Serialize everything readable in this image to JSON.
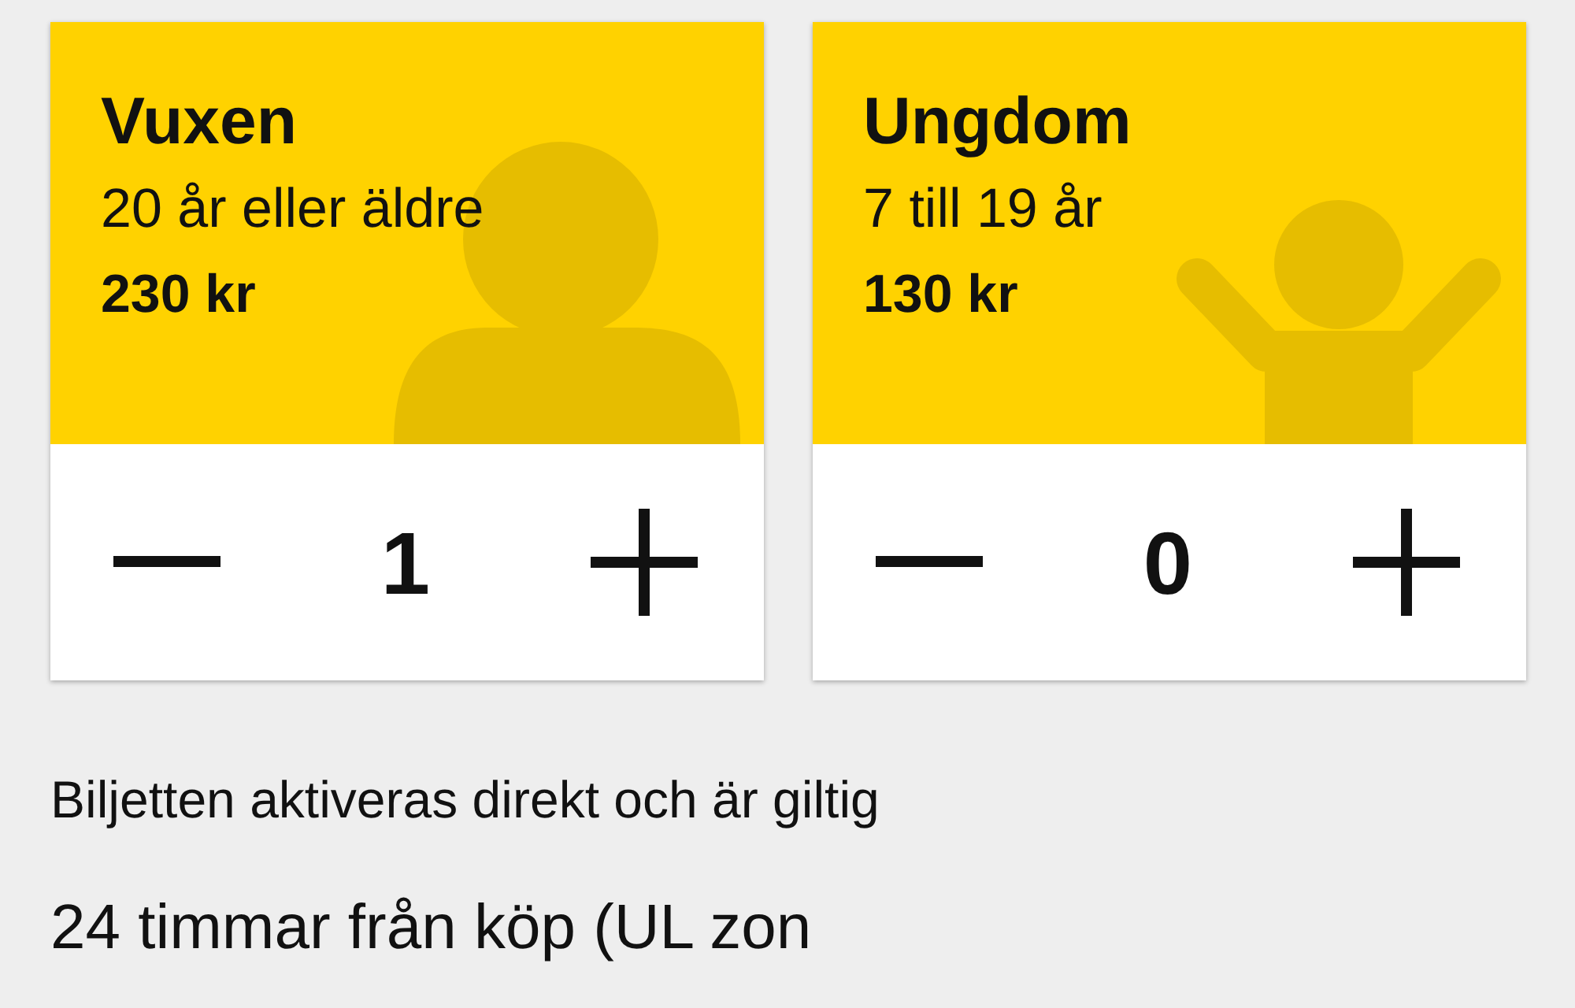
{
  "tickets": [
    {
      "kind": "adult",
      "name": "Vuxen",
      "age": "20 år eller äldre",
      "price": "230 kr",
      "count": "1"
    },
    {
      "kind": "child",
      "name": "Ungdom",
      "age": "7 till 19 år",
      "price": "130 kr",
      "count": "0"
    }
  ],
  "info": [
    "Biljetten aktiveras direkt och är giltig",
    "24 timmar från köp (UL zon"
  ]
}
